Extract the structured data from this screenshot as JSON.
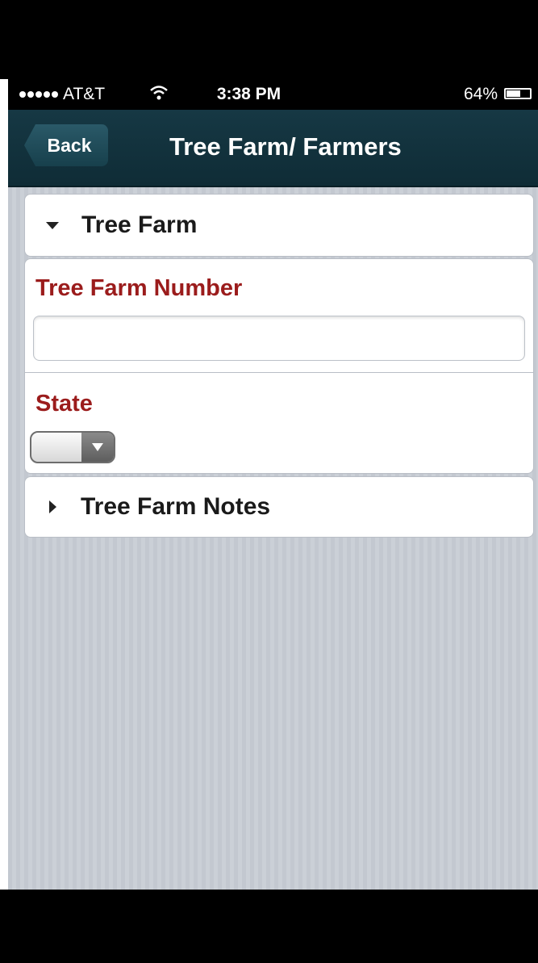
{
  "status_bar": {
    "carrier": "AT&T",
    "time": "3:38 PM",
    "battery": "64%",
    "battery_level": 0.64,
    "signal_icon": "signal-dots-icon",
    "wifi_icon": "wifi-icon",
    "battery_icon": "battery-icon"
  },
  "nav": {
    "back_label": "Back",
    "title": "Tree Farm/ Farmers"
  },
  "sections": {
    "tree_farm": {
      "header": "Tree Farm",
      "expanded": true,
      "icon": "caret-down-icon"
    },
    "tree_farm_notes": {
      "header": "Tree Farm Notes",
      "expanded": false,
      "icon": "caret-right-icon"
    }
  },
  "form": {
    "tree_farm_number": {
      "label": "Tree Farm Number",
      "value": "",
      "placeholder": ""
    },
    "state": {
      "label": "State",
      "selected": ""
    }
  },
  "colors": {
    "nav_background": "#163844",
    "label_red": "#9b1c1c",
    "content_background": "#c3c8d0"
  }
}
